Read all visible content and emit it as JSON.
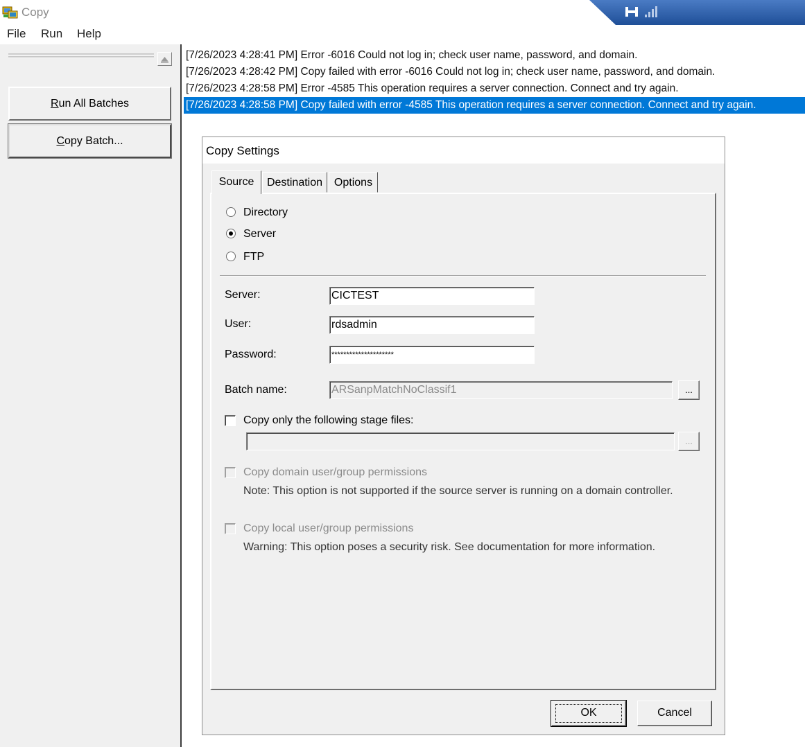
{
  "window": {
    "title": "Copy"
  },
  "menu": [
    {
      "label": "File"
    },
    {
      "label": "Run"
    },
    {
      "label": "Help"
    }
  ],
  "sidebar": {
    "run_all": {
      "prefix": "",
      "mnemonic": "R",
      "rest": "un All Batches"
    },
    "copy_batch": {
      "prefix": "",
      "mnemonic": "C",
      "rest": "opy Batch..."
    }
  },
  "log": [
    "[7/26/2023 4:28:41 PM] Error -6016 Could not log in; check user name, password, and domain.",
    "[7/26/2023 4:28:42 PM] Copy failed with error -6016 Could not log in; check user name, password, and domain.",
    "[7/26/2023 4:28:58 PM] Error -4585 This operation requires a server connection.  Connect and try again.",
    "[7/26/2023 4:28:58 PM] Copy failed with error -4585 This operation requires a server connection.  Connect and try again."
  ],
  "dialog": {
    "title": "Copy Settings",
    "tabs": [
      {
        "label": "Source"
      },
      {
        "label": "Destination"
      },
      {
        "label": "Options"
      }
    ],
    "source_types": [
      {
        "label": "Directory",
        "selected": false
      },
      {
        "label": "Server",
        "selected": true
      },
      {
        "label": "FTP",
        "selected": false
      }
    ],
    "server": {
      "label": "Server:",
      "value": "CICTEST"
    },
    "user": {
      "label": "User:",
      "value": "rdsadmin"
    },
    "password": {
      "label": "Password:",
      "value": "*********************"
    },
    "batch_name": {
      "label": "Batch name:",
      "value": "ARSanpMatchNoClassif1",
      "browse": "..."
    },
    "stage_files": {
      "label": "Copy only the following stage files:",
      "value": "",
      "browse": "...",
      "checked": false
    },
    "domain_perms": {
      "label": "Copy domain user/group permissions",
      "note": "Note: This option is not supported if the source server is running on a domain controller."
    },
    "local_perms": {
      "label": "Copy local user/group permissions",
      "note": "Warning: This option poses a security risk. See documentation for more information."
    },
    "ok": "OK",
    "cancel": "Cancel"
  },
  "colors": {
    "selection": "#0078d7",
    "conn_bar": "#2c5aa0"
  },
  "icons": {
    "app": "copy-app-icon",
    "connection": "connection-status-icon",
    "collapse": "collapse-up-icon"
  }
}
